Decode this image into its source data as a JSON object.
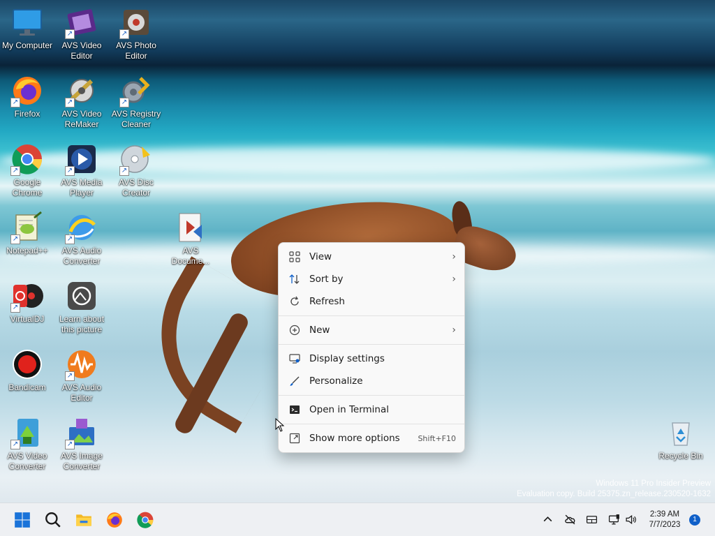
{
  "desktop": {
    "icons": [
      {
        "label": "My Computer",
        "icon": "computer-icon"
      },
      {
        "label": "AVS Video Editor",
        "icon": "film-icon"
      },
      {
        "label": "AVS Photo Editor",
        "icon": "photo-editor-icon"
      },
      {
        "label": "Firefox",
        "icon": "firefox-icon"
      },
      {
        "label": "AVS Video ReMaker",
        "icon": "remaker-icon"
      },
      {
        "label": "AVS Registry Cleaner",
        "icon": "registry-icon"
      },
      {
        "label": "Google Chrome",
        "icon": "chrome-icon"
      },
      {
        "label": "AVS Media Player",
        "icon": "media-player-icon"
      },
      {
        "label": "AVS Disc Creator",
        "icon": "disc-icon"
      },
      {
        "label": "Notepad++",
        "icon": "notepad-icon"
      },
      {
        "label": "AVS Audio Converter",
        "icon": "audio-converter-icon"
      },
      {
        "label": "AVS Docume...",
        "icon": "document-converter-icon"
      },
      {
        "label": "VirtualDJ",
        "icon": "virtualdj-icon"
      },
      {
        "label": "Learn about this picture",
        "icon": "camera-icon"
      },
      {
        "label": "Bandicam",
        "icon": "record-icon"
      },
      {
        "label": "AVS Audio Editor",
        "icon": "audio-editor-icon"
      },
      {
        "label": "AVS Video Converter",
        "icon": "video-converter-icon"
      },
      {
        "label": "AVS Image Converter",
        "icon": "image-converter-icon"
      },
      {
        "label": "Recycle Bin",
        "icon": "recycle-bin-icon"
      }
    ],
    "watermark": {
      "line1": "Windows 11 Pro Insider Preview",
      "line2": "Evaluation copy. Build 25375.zn_release.230520-1632"
    }
  },
  "context_menu": {
    "items": [
      {
        "label": "View",
        "icon": "grid-icon",
        "submenu": "›"
      },
      {
        "label": "Sort by",
        "icon": "sort-icon",
        "submenu": "›"
      },
      {
        "label": "Refresh",
        "icon": "refresh-icon"
      },
      {
        "label": "New",
        "icon": "plus-circle-icon",
        "submenu": "›"
      },
      {
        "label": "Display settings",
        "icon": "display-icon"
      },
      {
        "label": "Personalize",
        "icon": "brush-icon"
      },
      {
        "label": "Open in Terminal",
        "icon": "terminal-icon"
      },
      {
        "label": "Show more options",
        "icon": "more-options-icon",
        "shortcut": "Shift+F10"
      }
    ]
  },
  "taskbar": {
    "pinned": [
      {
        "icon": "windows-start-icon"
      },
      {
        "icon": "search-icon"
      },
      {
        "icon": "file-explorer-icon"
      },
      {
        "icon": "firefox-icon"
      },
      {
        "icon": "chrome-icon"
      }
    ],
    "tray": {
      "time": "2:39 AM",
      "date": "7/7/2023",
      "notification_count": "1"
    }
  },
  "colors": {
    "accent": "#1060c9",
    "menu_bg": "#f9f9f9",
    "taskbar_bg": "#eef0f3"
  }
}
